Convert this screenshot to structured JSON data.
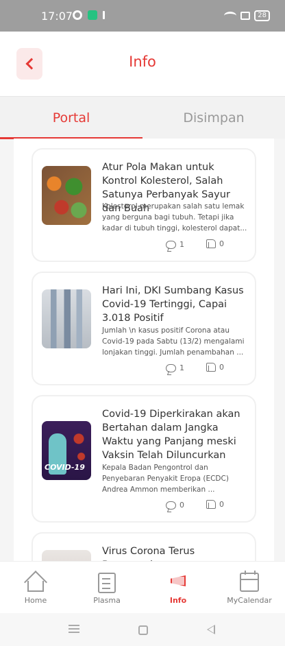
{
  "status_bar": {
    "time": "17:07",
    "battery": "28"
  },
  "header": {
    "title": "Info"
  },
  "tabs": [
    {
      "label": "Portal",
      "active": true
    },
    {
      "label": "Disimpan",
      "active": false
    }
  ],
  "articles": [
    {
      "title": "Atur Pola Makan untuk Kontrol Kolesterol, Salah Satunya Perbanyak Sayur dan Buah",
      "excerpt": "Kolesterol merupakan salah satu lemak yang berguna bagi tubuh. Tetapi jika kadar di tubuh tinggi, kolesterol dapat...",
      "comments": "1",
      "likes": "0"
    },
    {
      "title": "Hari Ini, DKI Sumbang Kasus Covid-19 Tertinggi, Capai 3.018 Positif",
      "excerpt": "Jumlah \\n  kasus positif Corona atau Covid-19 pada Sabtu (13/2) mengalami lonjakan tinggi. Jumlah penambahan ...",
      "comments": "1",
      "likes": "0"
    },
    {
      "title": "Covid-19 Diperkirakan akan Bertahan dalam Jangka Waktu yang Panjang meski Vaksin Telah Diluncurkan",
      "excerpt": "Kepala Badan Pengontrol dan Penyebaran Penyakit Eropa (ECDC) Andrea Ammon memberikan ...",
      "comments": "0",
      "likes": "0",
      "thumb_text": "COVID-19"
    },
    {
      "title": "Virus Corona Terus Bermutasi,"
    }
  ],
  "bottom_nav": [
    {
      "label": "Home",
      "icon": "home-icon"
    },
    {
      "label": "Plasma",
      "icon": "clipboard-icon"
    },
    {
      "label": "Info",
      "icon": "megaphone-icon",
      "active": true
    },
    {
      "label": "MyCalendar",
      "icon": "calendar-icon"
    }
  ],
  "colors": {
    "accent": "#e53935",
    "inactive": "#999999"
  }
}
